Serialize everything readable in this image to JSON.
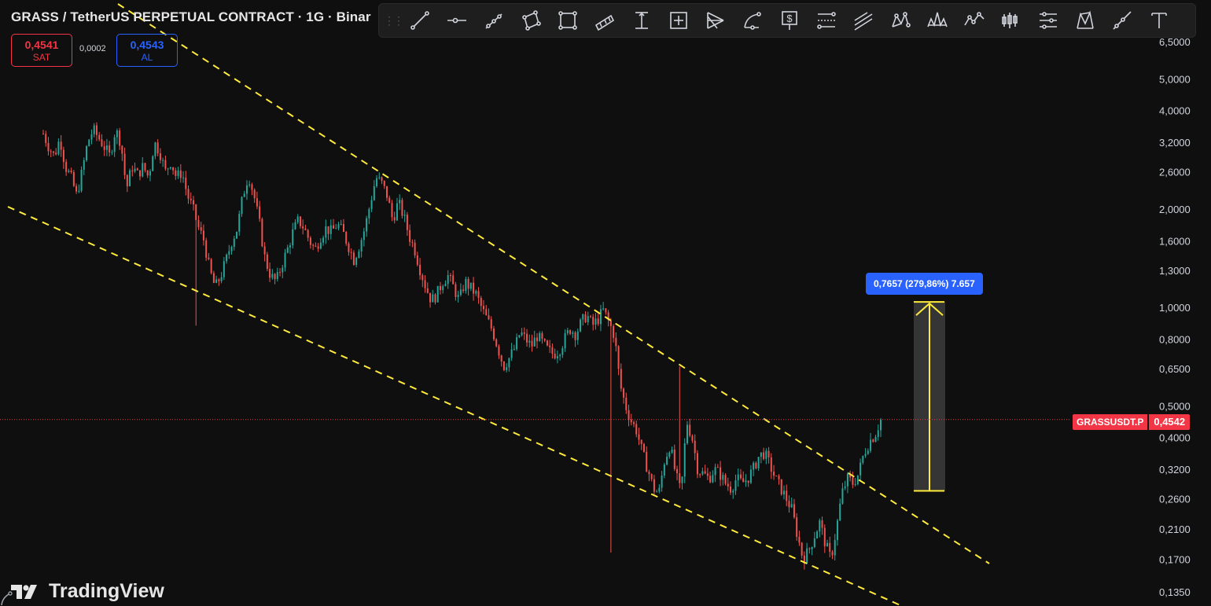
{
  "header": {
    "title": "GRASS / TetherUS PERPETUAL CONTRACT · 1G · Binar"
  },
  "trade": {
    "sell_price": "0,4541",
    "sell_label": "SAT",
    "spread": "0,0002",
    "buy_price": "0,4543",
    "buy_label": "AL"
  },
  "toolbar": {
    "tools": [
      "trend-line-icon",
      "horizontal-ray-icon",
      "parallel-channel-icon",
      "rotated-rectangle-icon",
      "rectangle-icon",
      "channel-icon",
      "price-range-icon",
      "date-price-range-icon",
      "pitchfork-icon",
      "arc-icon",
      "long-position-icon",
      "fib-retracement-icon",
      "fib-extension-icon",
      "xabcd-pattern-icon",
      "head-shoulders-icon",
      "elliott-wave-icon",
      "bars-pattern-icon",
      "gann-fan-icon",
      "cypher-pattern-icon",
      "ray-icon",
      "text-icon"
    ]
  },
  "branding": {
    "logo_text": "TradingView"
  },
  "price_tag": {
    "symbol": "GRASSUSDT.P",
    "price": "0,4542"
  },
  "measure": {
    "label": "0,7657 (279,86%) 7.657"
  },
  "colors": {
    "background": "#0f0f0f",
    "up": "#26a69a",
    "down": "#ef5350",
    "trendline": "#ffeb3b",
    "accent": "#2962ff",
    "sell": "#f23645"
  },
  "chart_data": {
    "type": "candlestick",
    "scale": "log",
    "y_ticks": [
      "6,5000",
      "5,0000",
      "4,0000",
      "3,2000",
      "2,6000",
      "2,0000",
      "1,6000",
      "1,3000",
      "1,0000",
      "0,8000",
      "0,6500",
      "0,5000",
      "0,4000",
      "0,3200",
      "0,2600",
      "0,2100",
      "0,1700",
      "0,1350"
    ],
    "y_tick_values": [
      6.5,
      5.0,
      4.0,
      3.2,
      2.6,
      2.0,
      1.6,
      1.3,
      1.0,
      0.8,
      0.65,
      0.5,
      0.4,
      0.32,
      0.26,
      0.21,
      0.17,
      0.135
    ],
    "last_price": 0.4542,
    "measure_from": 0.275,
    "measure_to": 1.04,
    "series": [
      {
        "name": "GRASSUSDT.P",
        "closes": [
          3.4,
          3.1,
          2.9,
          3.3,
          2.7,
          2.5,
          2.2,
          2.6,
          3.2,
          3.5,
          3.3,
          3.1,
          2.9,
          3.5,
          3.2,
          2.3,
          2.7,
          2.55,
          2.7,
          2.5,
          3.2,
          3.0,
          2.6,
          2.8,
          2.5,
          2.6,
          2.2,
          2.0,
          1.75,
          1.6,
          1.3,
          1.15,
          1.25,
          1.4,
          1.6,
          1.75,
          2.2,
          2.55,
          2.2,
          1.8,
          1.4,
          1.25,
          1.2,
          1.35,
          1.5,
          1.7,
          1.85,
          1.75,
          1.6,
          1.5,
          1.65,
          1.75,
          1.7,
          1.8,
          1.7,
          1.55,
          1.4,
          1.55,
          1.75,
          2.1,
          2.5,
          2.4,
          2.2,
          1.85,
          2.1,
          1.9,
          1.65,
          1.5,
          1.3,
          1.15,
          1.05,
          1.1,
          1.2,
          1.25,
          1.15,
          1.05,
          1.2,
          1.15,
          1.1,
          1.0,
          0.92,
          0.85,
          0.75,
          0.66,
          0.7,
          0.75,
          0.84,
          0.8,
          0.76,
          0.82,
          0.78,
          0.74,
          0.72,
          0.74,
          0.8,
          0.86,
          0.83,
          0.9,
          0.95,
          0.88,
          0.92,
          0.98,
          0.9,
          0.82,
          0.58,
          0.5,
          0.45,
          0.42,
          0.36,
          0.32,
          0.28,
          0.27,
          0.34,
          0.38,
          0.31,
          0.27,
          0.45,
          0.4,
          0.32,
          0.31,
          0.3,
          0.32,
          0.31,
          0.29,
          0.28,
          0.3,
          0.29,
          0.3,
          0.32,
          0.35,
          0.36,
          0.33,
          0.3,
          0.28,
          0.26,
          0.24,
          0.2,
          0.17,
          0.18,
          0.2,
          0.22,
          0.19,
          0.17,
          0.21,
          0.27,
          0.3,
          0.29,
          0.31,
          0.36,
          0.39,
          0.41,
          0.4542
        ]
      }
    ]
  }
}
